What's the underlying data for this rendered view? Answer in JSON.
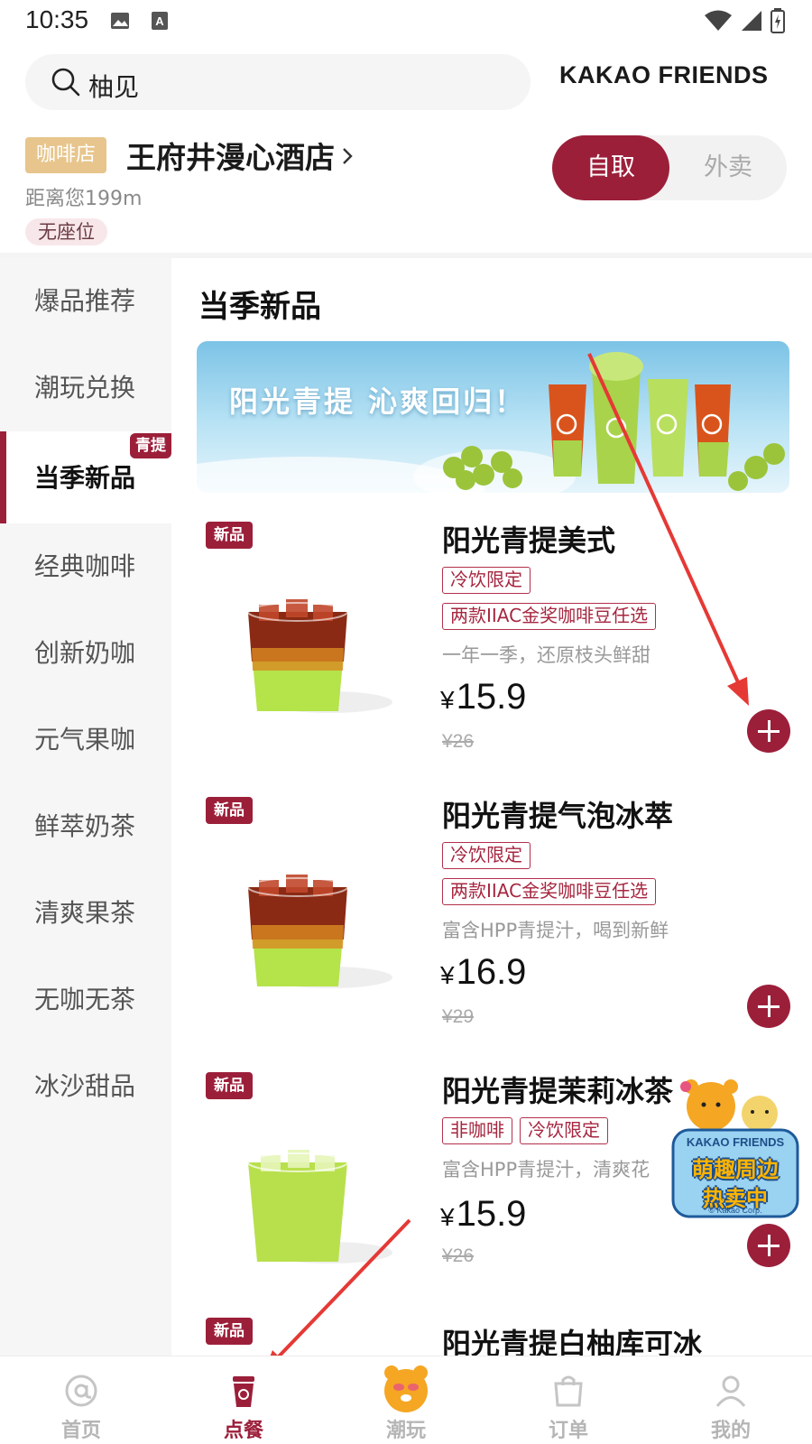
{
  "status_bar": {
    "time": "10:35"
  },
  "header": {
    "search_text": "柚见",
    "brand_logo": "KAKAO FRIENDS"
  },
  "store": {
    "type_badge": "咖啡店",
    "name": "王府井漫心酒店",
    "distance": "距离您199m",
    "seat_tag": "无座位"
  },
  "mode_toggle": {
    "pickup": "自取",
    "delivery": "外卖",
    "selected": "自取"
  },
  "sidebar": {
    "items": [
      {
        "label": "爆品推荐"
      },
      {
        "label": "潮玩兑换"
      },
      {
        "label": "当季新品",
        "badge": "青提",
        "active": true
      },
      {
        "label": "经典咖啡"
      },
      {
        "label": "创新奶咖"
      },
      {
        "label": "元气果咖"
      },
      {
        "label": "鲜萃奶茶"
      },
      {
        "label": "清爽果茶"
      },
      {
        "label": "无咖无茶"
      },
      {
        "label": "冰沙甜品"
      }
    ]
  },
  "section": {
    "title": "当季新品",
    "banner_text": "阳光青提 沁爽回归！"
  },
  "products": [
    {
      "badge": "新品",
      "name": "阳光青提美式",
      "tags": [
        [
          "冷饮限定"
        ],
        [
          "两款IIAC金奖咖啡豆任选"
        ]
      ],
      "desc": "一年一季，还原枝头鲜甜",
      "currency": "¥",
      "price": "15.9",
      "old_price": "¥26"
    },
    {
      "badge": "新品",
      "name": "阳光青提气泡冰萃",
      "tags": [
        [
          "冷饮限定"
        ],
        [
          "两款IIAC金奖咖啡豆任选"
        ]
      ],
      "desc": "富含HPP青提汁，喝到新鲜",
      "currency": "¥",
      "price": "16.9",
      "old_price": "¥29"
    },
    {
      "badge": "新品",
      "name": "阳光青提茉莉冰茶",
      "tags": [
        [
          "非咖啡",
          "冷饮限定"
        ]
      ],
      "desc": "富含HPP青提汁，清爽花",
      "currency": "¥",
      "price": "15.9",
      "old_price": "¥26"
    },
    {
      "badge": "新品",
      "name": "阳光青提白柚库可冰"
    }
  ],
  "promo": {
    "brand": "KAKAO FRIENDS",
    "line1": "萌趣周边",
    "line2": "热卖中",
    "copyright": "© Kakao Corp."
  },
  "bottom_nav": [
    {
      "label": "首页",
      "icon": "at-sign-icon"
    },
    {
      "label": "点餐",
      "icon": "coffee-cup-icon",
      "active": true
    },
    {
      "label": "潮玩",
      "icon": "ryan-character-icon"
    },
    {
      "label": "订单",
      "icon": "shopping-bag-icon"
    },
    {
      "label": "我的",
      "icon": "user-icon"
    }
  ],
  "colors": {
    "primary": "#9c1f3a",
    "store_badge": "#e7c58c",
    "annotation_arrow": "#e53935"
  }
}
